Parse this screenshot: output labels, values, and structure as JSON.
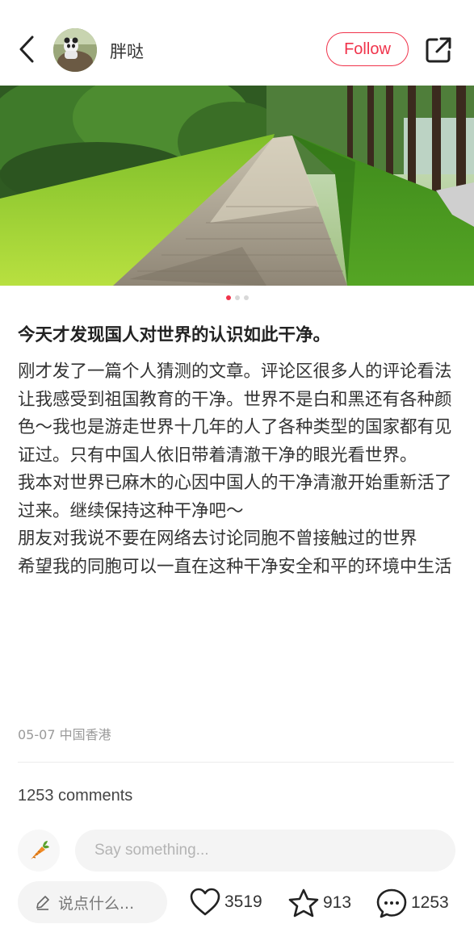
{
  "header": {
    "author_name": "胖哒",
    "follow_label": "Follow"
  },
  "carousel": {
    "total": 3,
    "active_index": 0
  },
  "post": {
    "title": "今天才发现国人对世界的认识如此干净。",
    "paragraphs": [
      "刚才发了一篇个人猜测的文章。评论区很多人的评论看法让我感受到祖国教育的干净。世界不是白和黑还有各种颜色～我也是游走世界十几年的人了各种类型的国家都有见证过。只有中国人依旧带着清澈干净的眼光看世界。",
      "我本对世界已麻木的心因中国人的干净清澈开始重新活了过来。继续保持这种干净吧～",
      "朋友对我说不要在网络去讨论同胞不曾接触过的世界",
      "希望我的同胞可以一直在这种干净安全和平的环境中生活"
    ],
    "meta": "05-07 中国香港"
  },
  "comments": {
    "count_label": "1253 comments",
    "input_placeholder": "Say something..."
  },
  "bottom_bar": {
    "input_label": "说点什么...",
    "likes": "3519",
    "stars": "913",
    "comments": "1253"
  },
  "colors": {
    "accent": "#f0334b",
    "text": "#333333",
    "muted": "#9a9a9a"
  },
  "icons": [
    "back-arrow-icon",
    "share-icon",
    "carrot-icon",
    "pencil-icon",
    "heart-icon",
    "star-icon",
    "comment-bubble-icon"
  ]
}
